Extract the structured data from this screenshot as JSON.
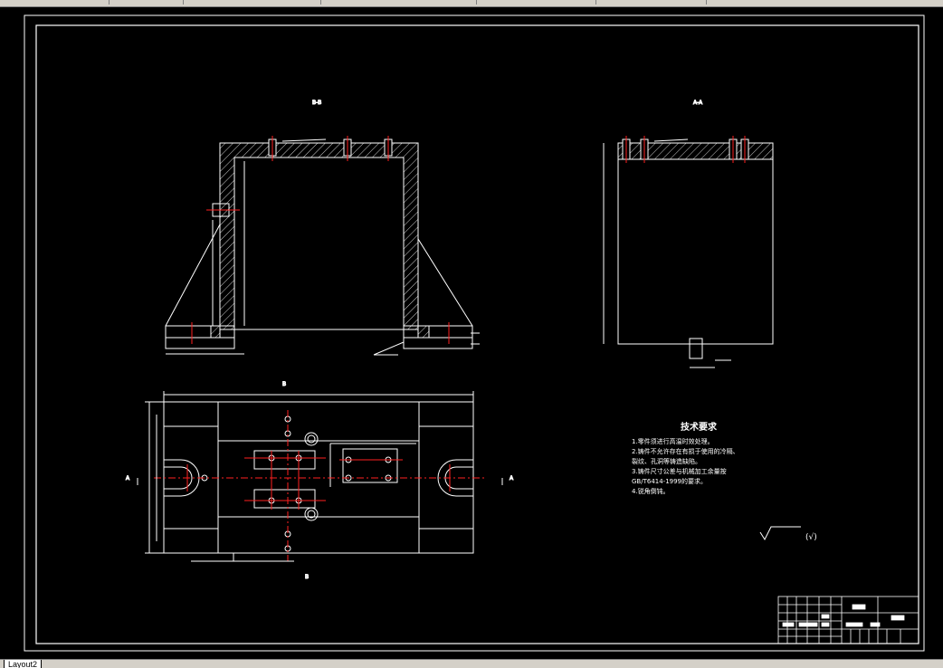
{
  "app": {
    "layout_tab_label": "Layout2"
  },
  "drawing": {
    "tech_req_title": "技术要求",
    "tech_req_lines": [
      "1.零件须进行高温时效处理。",
      "2.铸件不允许存在有损于使用的冷隔、",
      "裂纹、孔洞等铸造缺陷。",
      "3.铸件尺寸公差与机械加工余量按",
      "GB/T6414-1999的要求。",
      "4.锐角倒钝。"
    ],
    "view_label_left": "B-B",
    "view_label_right": "A-A",
    "section_mark_b_top": "B",
    "section_mark_b_bottom": "B",
    "section_mark_a_left": "A",
    "section_mark_a_right": "A",
    "roughness_note": "(√)"
  },
  "colors": {
    "background": "#000000",
    "line": "#ffffff",
    "centerline": "#ff2020",
    "frame_ui": "#d4d0c8"
  }
}
